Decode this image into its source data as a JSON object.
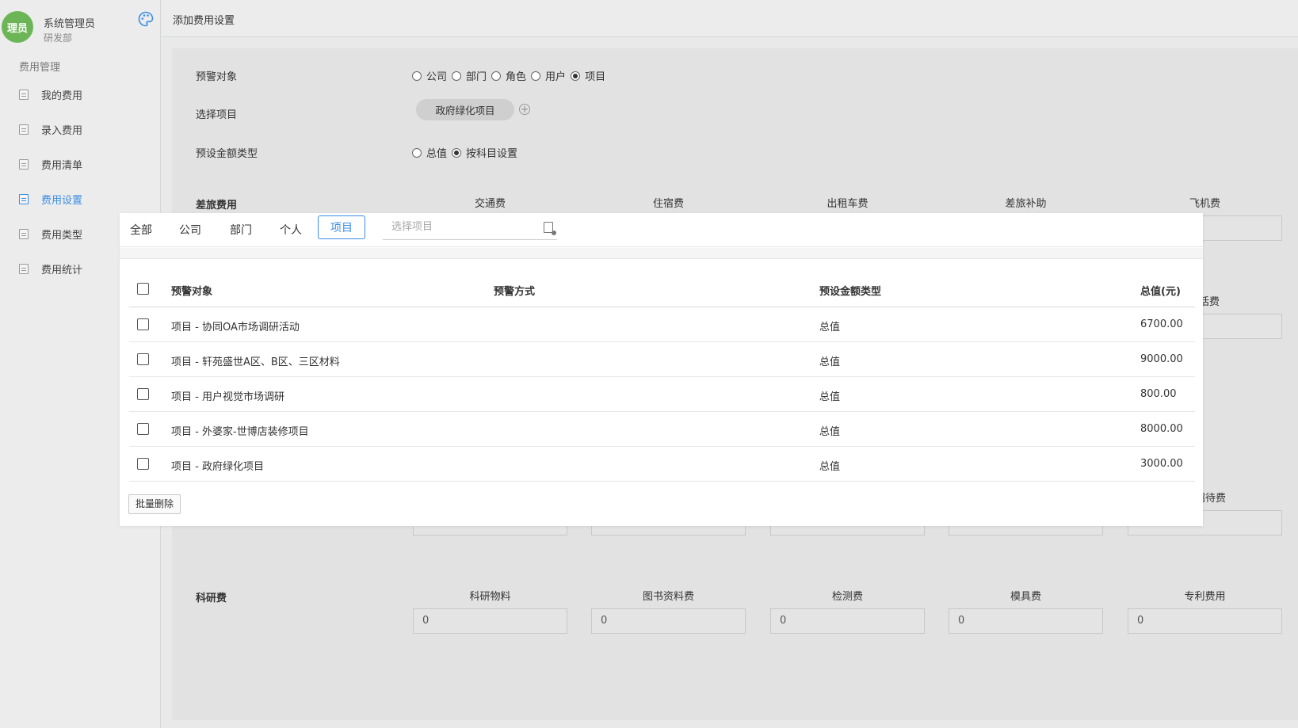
{
  "user": {
    "avatar_text": "理员",
    "name": "系统管理员",
    "dept": "研发部"
  },
  "sidebar": {
    "group_label": "费用管理",
    "items": [
      {
        "label": "我的费用"
      },
      {
        "label": "录入费用"
      },
      {
        "label": "费用清单"
      },
      {
        "label": "费用设置"
      },
      {
        "label": "费用类型"
      },
      {
        "label": "费用统计"
      }
    ],
    "active_index": 3
  },
  "header": {
    "title": "添加费用设置"
  },
  "form": {
    "alert_target_label": "预警对象",
    "alert_target_options": [
      "公司",
      "部门",
      "角色",
      "用户",
      "项目"
    ],
    "alert_target_selected": "项目",
    "select_project_label": "选择项目",
    "selected_project_tag": "政府绿化项目",
    "preset_amount_label": "预设金额类型",
    "preset_amount_options": [
      "总值",
      "按科目设置"
    ],
    "preset_amount_selected": "按科目设置",
    "travel_section": {
      "label": "差旅费用",
      "columns": [
        "交通费",
        "住宿费",
        "出租车费",
        "差旅补助",
        "飞机费"
      ]
    },
    "partial_labels": {
      "row2_col5": "话费",
      "row3_col5": "招待费"
    },
    "research_section": {
      "label": "科研费",
      "columns": [
        "科研物料",
        "图书资料费",
        "检测费",
        "模具费",
        "专利费用"
      ],
      "values": [
        "0",
        "0",
        "0",
        "0",
        "0"
      ]
    }
  },
  "popup": {
    "tabs": [
      "全部",
      "公司",
      "部门",
      "个人",
      "项目"
    ],
    "active_tab": "项目",
    "search_placeholder": "选择项目",
    "table": {
      "headers": {
        "target": "预警对象",
        "mode": "预警方式",
        "type": "预设金额类型",
        "total": "总值(元)"
      },
      "rows": [
        {
          "target": "项目 - 协同OA市场调研活动",
          "mode": "",
          "type": "总值",
          "total": "6700.00"
        },
        {
          "target": "项目 - 轩苑盛世A区、B区、三区材料",
          "mode": "",
          "type": "总值",
          "total": "9000.00"
        },
        {
          "target": "项目 - 用户视觉市场调研",
          "mode": "",
          "type": "总值",
          "total": "800.00"
        },
        {
          "target": "项目 - 外婆家-世博店装修项目",
          "mode": "",
          "type": "总值",
          "total": "8000.00"
        },
        {
          "target": "项目 - 政府绿化项目",
          "mode": "",
          "type": "总值",
          "total": "3000.00"
        }
      ]
    },
    "batch_delete_label": "批量删除"
  },
  "colors": {
    "accent": "#3a8ee6",
    "avatar": "#6cb556"
  }
}
